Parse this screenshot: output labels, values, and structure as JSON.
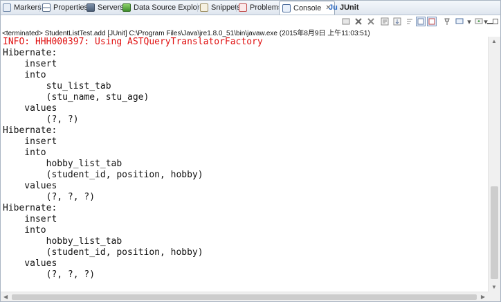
{
  "tabs": [
    {
      "label": "Markers",
      "icon": "markers-icon"
    },
    {
      "label": "Properties",
      "icon": "properties-icon"
    },
    {
      "label": "Servers",
      "icon": "servers-icon"
    },
    {
      "label": "Data Source Explorer",
      "icon": "data-source-explorer-icon"
    },
    {
      "label": "Snippets",
      "icon": "snippets-icon"
    },
    {
      "label": "Problems",
      "icon": "problems-icon"
    },
    {
      "label": "Console",
      "icon": "console-icon",
      "active": true,
      "close": "✕"
    },
    {
      "label": "JUnit",
      "icon": "junit-icon"
    }
  ],
  "toolbar": {
    "icons": [
      "remove-launch-icon",
      "terminate-icon",
      "remove-all-terminated-icon",
      "clear-console-icon",
      "scroll-lock-icon",
      "word-wrap-icon",
      "show-when-stdout-icon",
      "show-when-stderr-icon",
      "pin-console-icon",
      "display-selected-console-icon",
      "open-console-icon",
      "minimize-icon",
      "maximize-icon"
    ]
  },
  "status_line": "<terminated> StudentListTest.add [JUnit] C:\\Program Files\\Java\\jre1.8.0_51\\bin\\javaw.exe (2015年8月9日 上午11:03:51)",
  "console": {
    "lines": [
      {
        "text": "INFO: HHH000397: Using ASTQueryTranslatorFactory",
        "style": "err"
      },
      {
        "text": "Hibernate: "
      },
      {
        "text": "    insert "
      },
      {
        "text": "    into"
      },
      {
        "text": "        stu_list_tab"
      },
      {
        "text": "        (stu_name, stu_age) "
      },
      {
        "text": "    values"
      },
      {
        "text": "        (?, ?)"
      },
      {
        "text": "Hibernate: "
      },
      {
        "text": "    insert "
      },
      {
        "text": "    into"
      },
      {
        "text": "        hobby_list_tab"
      },
      {
        "text": "        (student_id, position, hobby) "
      },
      {
        "text": "    values"
      },
      {
        "text": "        (?, ?, ?)"
      },
      {
        "text": "Hibernate: "
      },
      {
        "text": "    insert "
      },
      {
        "text": "    into"
      },
      {
        "text": "        hobby_list_tab"
      },
      {
        "text": "        (student_id, position, hobby) "
      },
      {
        "text": "    values"
      },
      {
        "text": "        (?, ?, ?)"
      }
    ]
  },
  "colors": {
    "error_text": "#e01010",
    "active_tab_bg": "#ffffff",
    "tabbar_bg": "#dfe6ef"
  }
}
